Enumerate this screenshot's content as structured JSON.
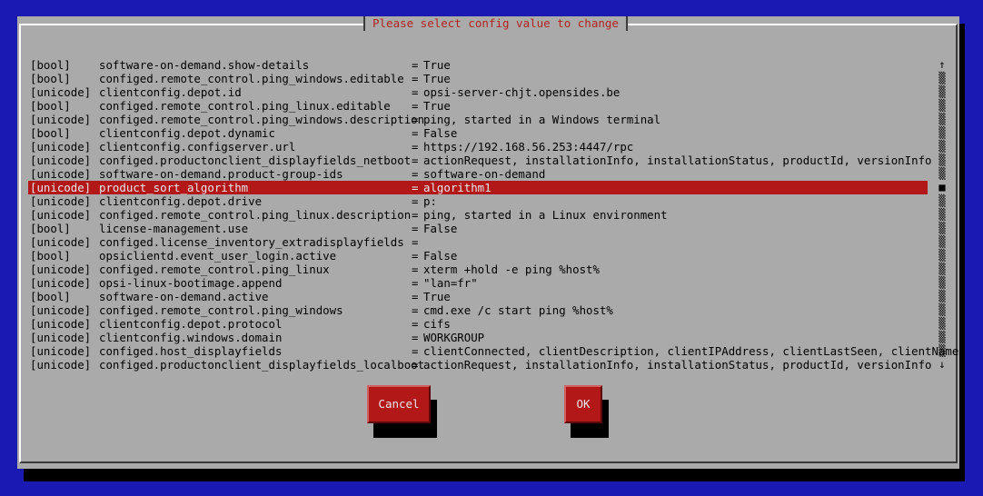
{
  "dialog": {
    "title": "Please select config value to change"
  },
  "rows": [
    {
      "type": "[bool]",
      "key": "software-on-demand.show-details",
      "eq": "=",
      "value": "True",
      "selected": false
    },
    {
      "type": "[bool]",
      "key": "configed.remote_control.ping_windows.editable",
      "eq": "=",
      "value": "True",
      "selected": false
    },
    {
      "type": "[unicode]",
      "key": "clientconfig.depot.id",
      "eq": "=",
      "value": "opsi-server-chjt.opensides.be",
      "selected": false
    },
    {
      "type": "[bool]",
      "key": "configed.remote_control.ping_linux.editable",
      "eq": "=",
      "value": "True",
      "selected": false
    },
    {
      "type": "[unicode]",
      "key": "configed.remote_control.ping_windows.description",
      "eq": "=",
      "value": "ping, started in a Windows terminal",
      "selected": false
    },
    {
      "type": "[bool]",
      "key": "clientconfig.depot.dynamic",
      "eq": "=",
      "value": "False",
      "selected": false
    },
    {
      "type": "[unicode]",
      "key": "clientconfig.configserver.url",
      "eq": "=",
      "value": "https://192.168.56.253:4447/rpc",
      "selected": false
    },
    {
      "type": "[unicode]",
      "key": "configed.productonclient_displayfields_netboot",
      "eq": "=",
      "value": "actionRequest, installationInfo, installationStatus, productId, versionInfo",
      "selected": false
    },
    {
      "type": "[unicode]",
      "key": "software-on-demand.product-group-ids",
      "eq": "=",
      "value": "software-on-demand",
      "selected": false
    },
    {
      "type": "[unicode]",
      "key": "product_sort_algorithm",
      "eq": "=",
      "value": "algorithm1",
      "selected": true
    },
    {
      "type": "[unicode]",
      "key": "clientconfig.depot.drive",
      "eq": "=",
      "value": "p:",
      "selected": false
    },
    {
      "type": "[unicode]",
      "key": "configed.remote_control.ping_linux.description",
      "eq": "=",
      "value": "ping, started in a Linux environment",
      "selected": false
    },
    {
      "type": "[bool]",
      "key": "license-management.use",
      "eq": "=",
      "value": "False",
      "selected": false
    },
    {
      "type": "[unicode]",
      "key": "configed.license_inventory_extradisplayfields",
      "eq": "=",
      "value": "",
      "selected": false
    },
    {
      "type": "[bool]",
      "key": "opsiclientd.event_user_login.active",
      "eq": "=",
      "value": "False",
      "selected": false
    },
    {
      "type": "[unicode]",
      "key": "configed.remote_control.ping_linux",
      "eq": "=",
      "value": "xterm +hold -e ping %host%",
      "selected": false
    },
    {
      "type": "[unicode]",
      "key": "opsi-linux-bootimage.append",
      "eq": "=",
      "value": "\"lan=fr\"",
      "selected": false
    },
    {
      "type": "[bool]",
      "key": "software-on-demand.active",
      "eq": "=",
      "value": "True",
      "selected": false
    },
    {
      "type": "[unicode]",
      "key": "configed.remote_control.ping_windows",
      "eq": "=",
      "value": "cmd.exe /c start ping %host%",
      "selected": false
    },
    {
      "type": "[unicode]",
      "key": "clientconfig.depot.protocol",
      "eq": "=",
      "value": "cifs",
      "selected": false
    },
    {
      "type": "[unicode]",
      "key": "clientconfig.windows.domain",
      "eq": "=",
      "value": "WORKGROUP",
      "selected": false
    },
    {
      "type": "[unicode]",
      "key": "configed.host_displayfields",
      "eq": "=",
      "value": "clientConnected, clientDescription, clientIPAddress, clientLastSeen, clientName",
      "selected": false
    },
    {
      "type": "[unicode]",
      "key": "configed.productonclient_displayfields_localboot",
      "eq": "=",
      "value": "actionRequest, installationInfo, installationStatus, productId, versionInfo",
      "selected": false
    }
  ],
  "scrollbar": {
    "up": "↑",
    "track": "▒",
    "thumb": "■",
    "down": "↓",
    "thumb_index": 9
  },
  "buttons": {
    "cancel_label": "Cancel",
    "ok_label": "OK"
  }
}
